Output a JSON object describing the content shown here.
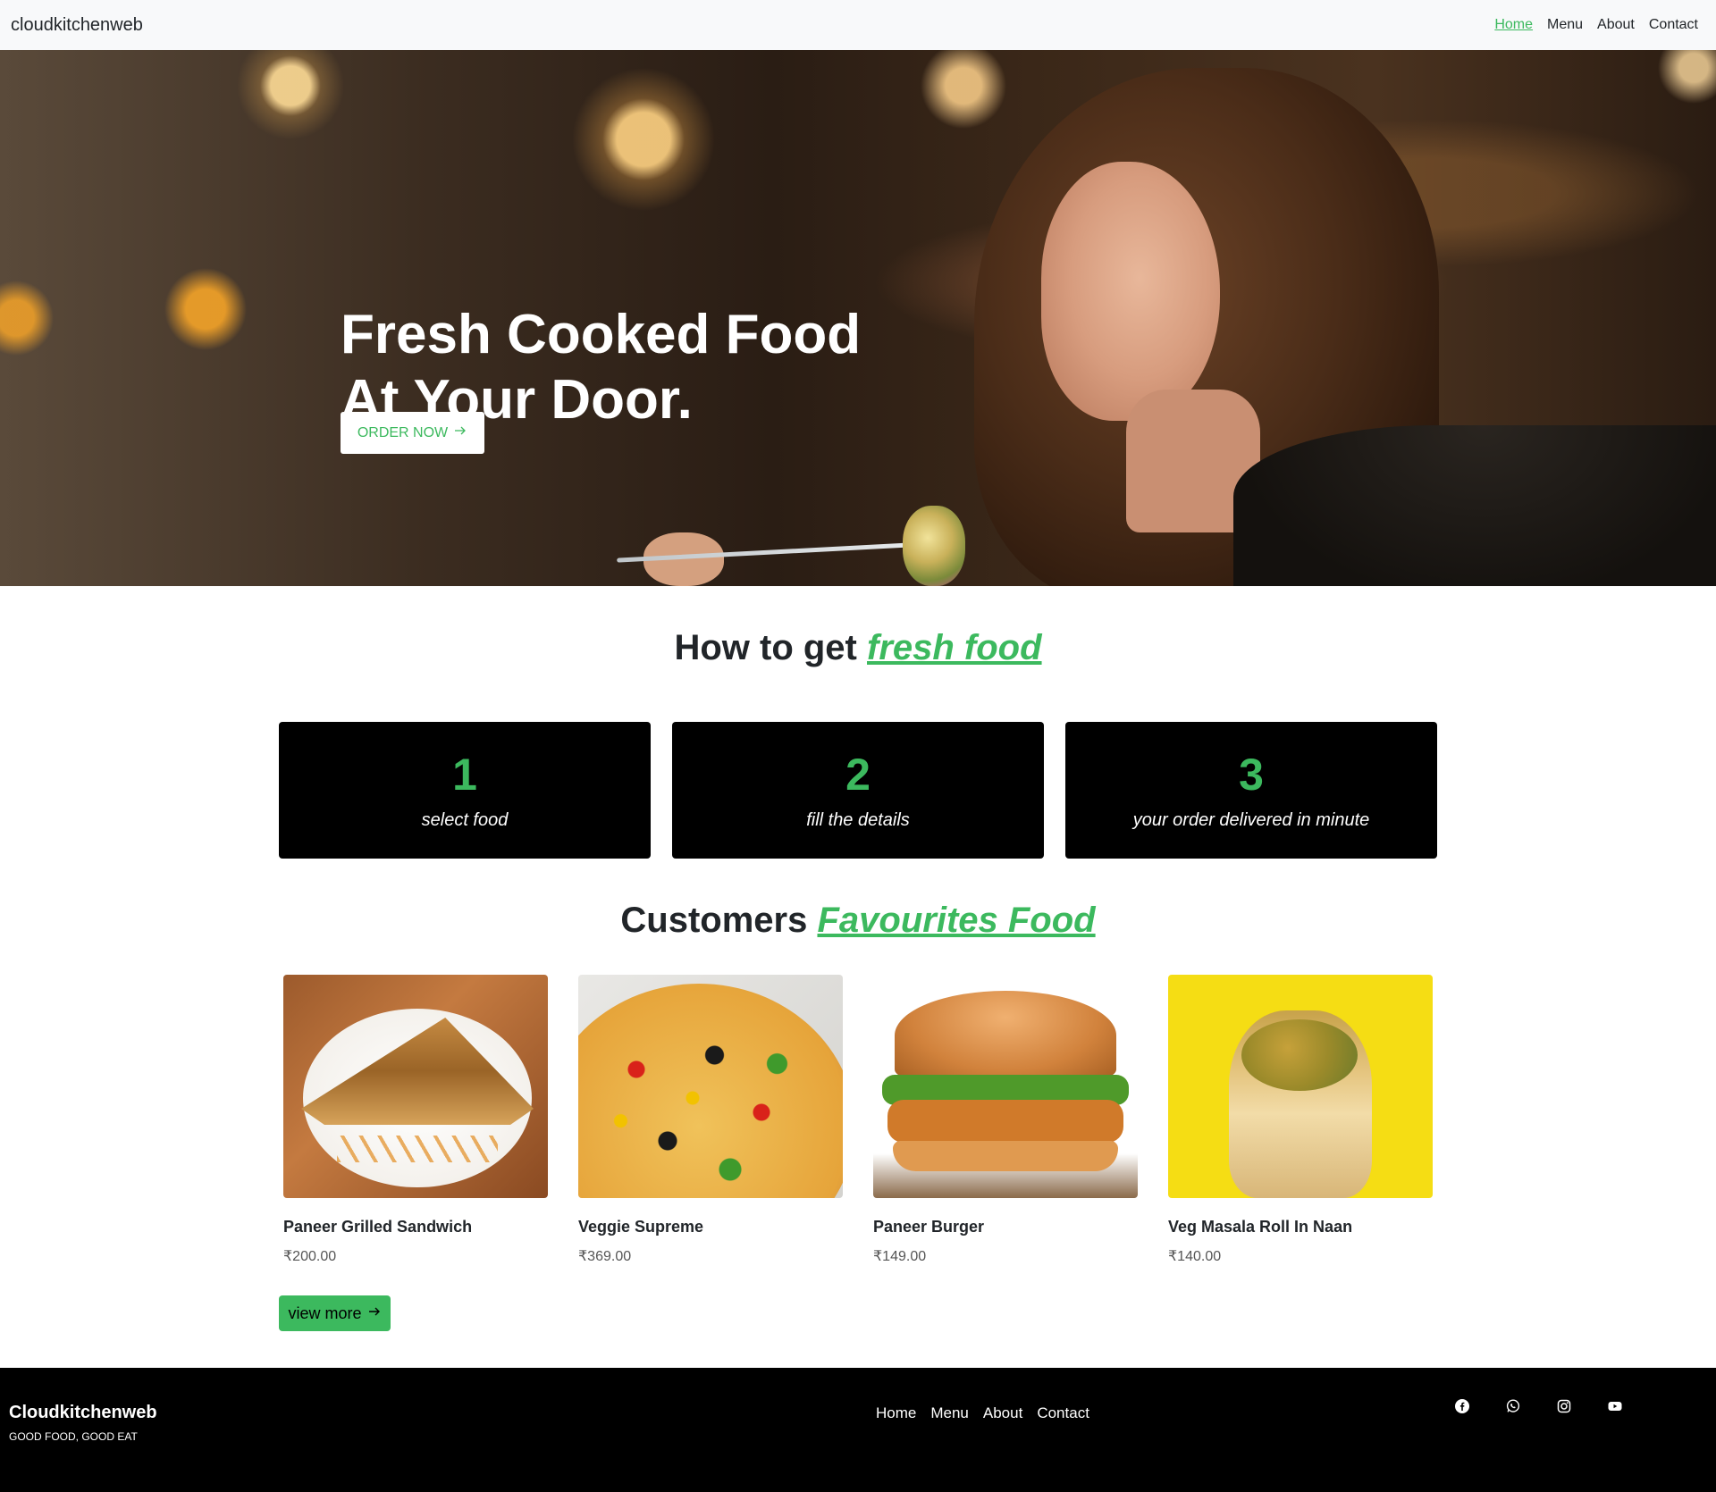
{
  "navbar": {
    "brand": "cloudkitchenweb",
    "links": [
      "Home",
      "Menu",
      "About",
      "Contact"
    ],
    "active_link": "Home",
    "accent_color": "#3cb95e"
  },
  "hero": {
    "title_line1": "Fresh Cooked Food",
    "title_line2": "At Your Door.",
    "cta_label": "ORDER NOW",
    "cta_icon": "arrow-right-icon"
  },
  "how_to": {
    "title_plain": "How to get",
    "title_accent": "fresh food",
    "steps": [
      {
        "number": "1",
        "text": "select food"
      },
      {
        "number": "2",
        "text": "fill the details"
      },
      {
        "number": "3",
        "text": "your order delivered in minute"
      }
    ]
  },
  "favourites": {
    "title_plain": "Customers",
    "title_accent": "Favourites Food",
    "items": [
      {
        "name": "Paneer Grilled Sandwich",
        "price": "₹200.00"
      },
      {
        "name": "Veggie Supreme",
        "price": "₹369.00"
      },
      {
        "name": "Paneer Burger",
        "price": "₹149.00"
      },
      {
        "name": "Veg Masala Roll In Naan",
        "price": "₹140.00"
      }
    ],
    "view_more_label": "view more"
  },
  "footer": {
    "brand": "Cloudkitchenweb",
    "tagline": "GOOD FOOD, GOOD EAT",
    "links": [
      "Home",
      "Menu",
      "About",
      "Contact"
    ],
    "social_icons": [
      "facebook-icon",
      "whatsapp-icon",
      "instagram-icon",
      "youtube-icon"
    ]
  }
}
